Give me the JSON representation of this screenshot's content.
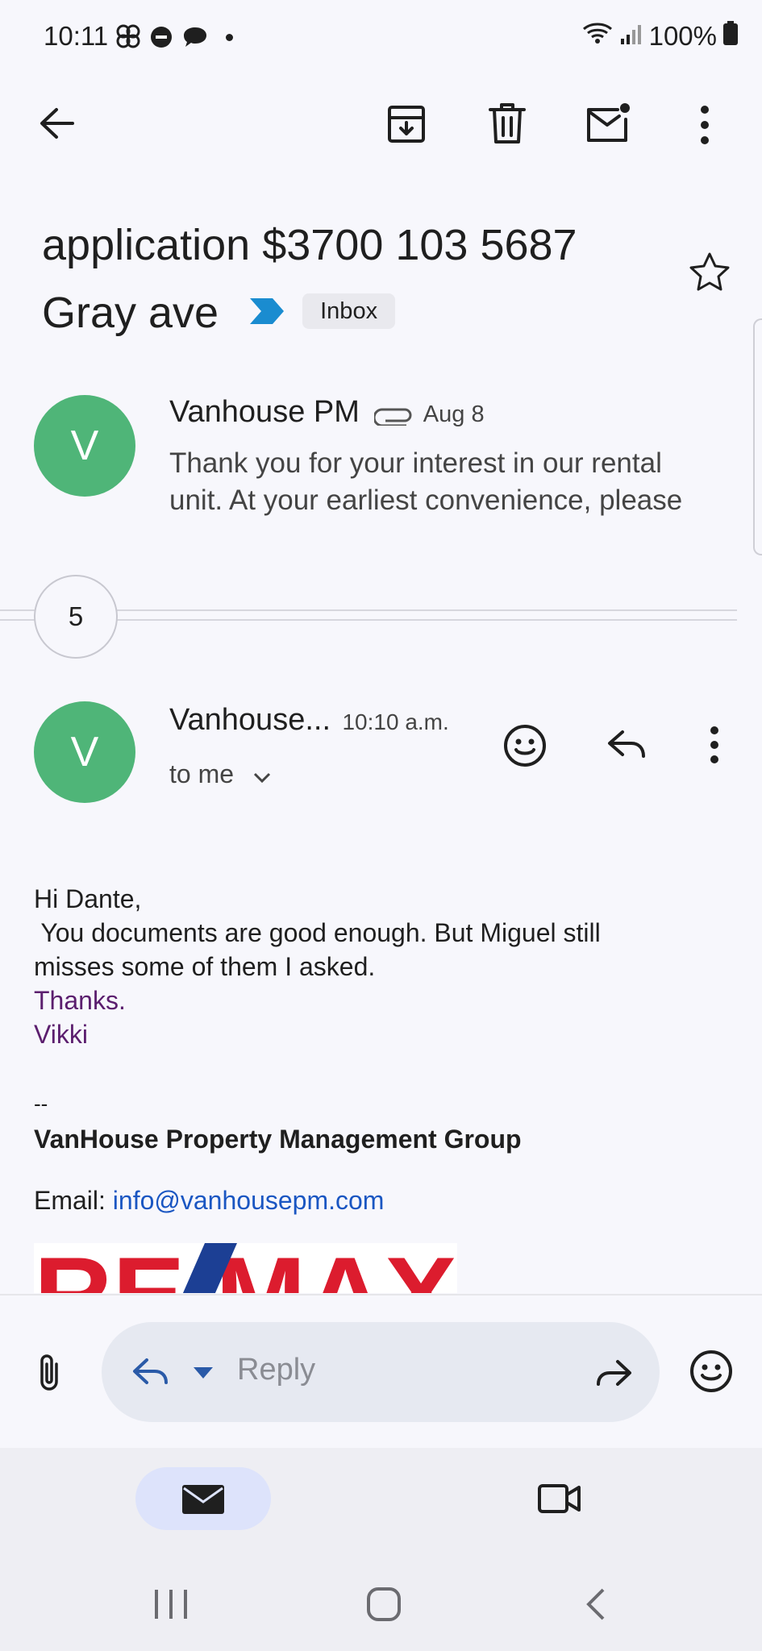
{
  "status_bar": {
    "time": "10:11",
    "battery": "100%"
  },
  "toolbar": {
    "back_icon": "arrow-left-icon",
    "archive_icon": "archive-icon",
    "delete_icon": "trash-icon",
    "mark_unread_icon": "mail-unread-icon",
    "more_icon": "more-vert-icon"
  },
  "thread": {
    "subject_line1": "application $3700 103 5687",
    "subject_line2": "Gray ave",
    "label": "Inbox",
    "collapsed_count": "5"
  },
  "message_1": {
    "avatar_letter": "V",
    "sender": "Vanhouse PM",
    "date": "Aug 8",
    "preview_line1": "Thank you for your interest in our rental",
    "preview_line2": "unit. At your earliest convenience, please"
  },
  "message_2": {
    "avatar_letter": "V",
    "sender": "Vanhouse...",
    "time": "10:10 a.m.",
    "recipient": "to me",
    "greeting": "Hi Dante,",
    "body_line1": " You documents are good enough. But Miguel still",
    "body_line2": "misses some of them I asked.",
    "signoff1": "Thanks.",
    "signoff2": "Vikki",
    "separator": "--",
    "company": "VanHouse Property Management Group",
    "email_label": "Email: ",
    "email": "info@vanhousepm.com",
    "logo_text": "RE/MAX"
  },
  "reply_bar": {
    "placeholder": "Reply"
  },
  "colors": {
    "avatar": "#4fb578",
    "link": "#1a56c2",
    "signoff": "#5b1e6e",
    "remax_red": "#dc1c2e",
    "remax_blue": "#1c3f94"
  }
}
